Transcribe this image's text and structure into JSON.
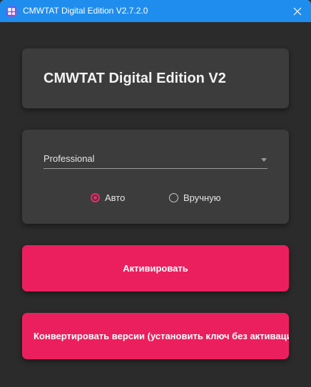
{
  "window": {
    "title": "CMWTAT Digital Edition V2.7.2.0",
    "icon": "windows-logo-icon",
    "close_icon": "close-icon",
    "titlebar_color": "#1f8ded",
    "background_color": "#2b2b2b"
  },
  "header_card": {
    "heading": "CMWTAT Digital Edition V2"
  },
  "options_card": {
    "edition_select": {
      "value": "Professional",
      "arrow_icon": "chevron-down-icon"
    },
    "mode": {
      "auto_label": "Авто",
      "manual_label": "Вручную",
      "selected": "auto"
    }
  },
  "buttons": {
    "activate_label": "Активировать",
    "convert_label": "Конвертировать версии (установить ключ без активации)",
    "accent_color": "#ec1f5e"
  }
}
